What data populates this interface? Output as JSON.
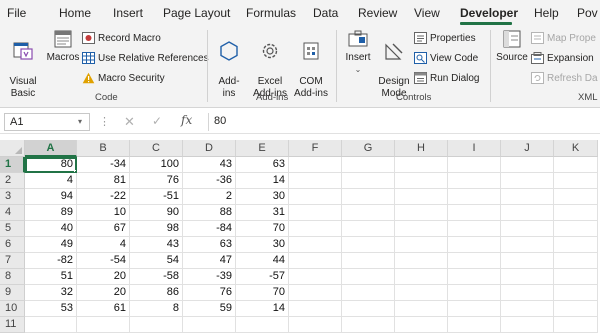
{
  "ribbon_tabs": [
    "File",
    "Home",
    "Insert",
    "Page Layout",
    "Formulas",
    "Data",
    "Review",
    "View",
    "Developer",
    "Help",
    "Pov"
  ],
  "active_tab": "Developer",
  "colors": {
    "accent": "#217346",
    "ribbon_bg": "#f3f3f3",
    "icon_blue": "#1f5fa8",
    "warning": "#e0a100"
  },
  "code_group": {
    "label": "Code",
    "visual_basic": "Visual\nBasic",
    "macros": "Macros",
    "record_macro": "Record Macro",
    "use_relative": "Use Relative References",
    "macro_security": "Macro Security"
  },
  "addins_group": {
    "label": "Add-ins",
    "addins": "Add-\nins",
    "excel_addins": "Excel\nAdd-ins",
    "com_addins": "COM\nAdd-ins"
  },
  "controls_group": {
    "label": "Controls",
    "insert": "Insert",
    "design_mode": "Design\nMode",
    "properties": "Properties",
    "view_code": "View Code",
    "run_dialog": "Run Dialog"
  },
  "xml_group": {
    "label": "XML",
    "source": "Source",
    "map_properties": "Map Prope",
    "expansion_packs": "Expansion",
    "refresh_data": "Refresh Da"
  },
  "formula_bar": {
    "name_box": "A1",
    "fx": "fx",
    "content": "80"
  },
  "grid": {
    "columns": [
      "A",
      "B",
      "C",
      "D",
      "E",
      "F",
      "G",
      "H",
      "I",
      "J",
      "K"
    ],
    "selected_column": "A",
    "selected_row": 1,
    "rows": [
      {
        "n": "1",
        "cells": [
          "80",
          "-34",
          "100",
          "43",
          "63"
        ]
      },
      {
        "n": "2",
        "cells": [
          "4",
          "81",
          "76",
          "-36",
          "14"
        ]
      },
      {
        "n": "3",
        "cells": [
          "94",
          "-22",
          "-51",
          "2",
          "30"
        ]
      },
      {
        "n": "4",
        "cells": [
          "89",
          "10",
          "90",
          "88",
          "31"
        ]
      },
      {
        "n": "5",
        "cells": [
          "40",
          "67",
          "98",
          "-84",
          "70"
        ]
      },
      {
        "n": "6",
        "cells": [
          "49",
          "4",
          "43",
          "63",
          "30"
        ]
      },
      {
        "n": "7",
        "cells": [
          "-82",
          "-54",
          "54",
          "47",
          "44"
        ]
      },
      {
        "n": "8",
        "cells": [
          "51",
          "20",
          "-58",
          "-39",
          "-57"
        ]
      },
      {
        "n": "9",
        "cells": [
          "32",
          "20",
          "86",
          "76",
          "70"
        ]
      },
      {
        "n": "10",
        "cells": [
          "53",
          "61",
          "8",
          "59",
          "14"
        ]
      },
      {
        "n": "11",
        "cells": [
          "",
          "",
          "",
          "",
          ""
        ]
      }
    ]
  }
}
